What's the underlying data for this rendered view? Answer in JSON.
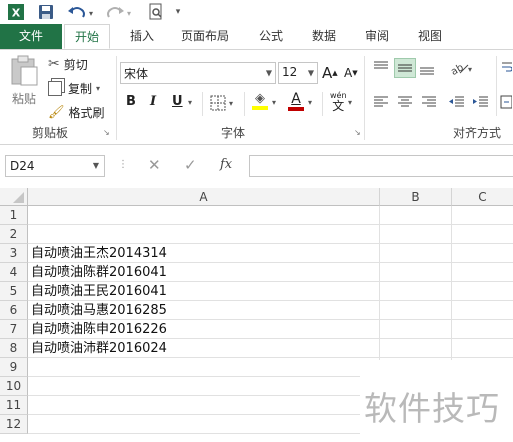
{
  "quick_access": {
    "icons": [
      "excel-logo-icon",
      "save-icon",
      "undo-icon",
      "redo-icon",
      "print-preview-icon",
      "customize-icon"
    ],
    "app_letter": "X"
  },
  "tabs": {
    "file": "文件",
    "items": [
      "开始",
      "插入",
      "页面布局",
      "公式",
      "数据",
      "审阅",
      "视图"
    ],
    "active": "开始"
  },
  "ribbon": {
    "clipboard": {
      "paste_label": "粘贴",
      "cut_label": "剪切",
      "copy_label": "复制",
      "format_painter_label": "格式刷",
      "group_label": "剪贴板"
    },
    "font": {
      "font_name": "宋体",
      "font_size": "12",
      "bold": "B",
      "italic": "I",
      "underline": "U",
      "font_color_letter": "A",
      "wen_label": "wén",
      "wen_char": "文",
      "group_label": "字体",
      "grow_letter": "A",
      "shrink_letter": "A"
    },
    "alignment": {
      "group_label": "对齐方式"
    }
  },
  "formula_bar": {
    "name_box": "D24",
    "fx_label": "fx",
    "formula": ""
  },
  "grid": {
    "columns": [
      "A",
      "B",
      "C"
    ],
    "rows": [
      "1",
      "2",
      "3",
      "4",
      "5",
      "6",
      "7",
      "8",
      "9",
      "10",
      "11",
      "12"
    ],
    "cells": {
      "A3": "自动喷油王杰2014314",
      "A4": "自动喷油陈群2016041",
      "A5": "自动喷油王民2016041",
      "A6": "自动喷油马惠2016285",
      "A7": "自动喷油陈申2016226",
      "A8": "自动喷油沛群2016024"
    }
  },
  "watermark": "软件技巧",
  "colors": {
    "excel_green": "#217346",
    "highlight_yellow": "#ffff00",
    "font_red": "#c00000"
  }
}
